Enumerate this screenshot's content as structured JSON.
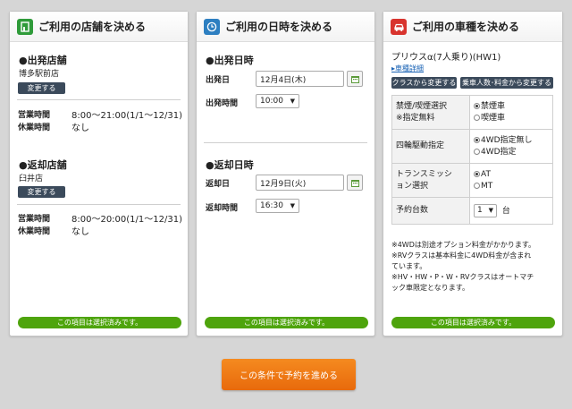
{
  "store_panel": {
    "title": "ご利用の店舗を決める",
    "departure": {
      "heading": "●出発店舗",
      "store_name": "博多駅前店",
      "change_label": "変更する",
      "hours_label": "営業時間",
      "hours_value": "8:00～21:00(1/1～12/31)",
      "closed_label": "休業時間",
      "closed_value": "なし"
    },
    "return": {
      "heading": "●返却店舗",
      "store_name": "臼井店",
      "change_label": "変更する",
      "hours_label": "営業時間",
      "hours_value": "8:00～20:00(1/1～12/31)",
      "closed_label": "休業時間",
      "closed_value": "なし"
    },
    "status": "この項目は選択済みです。"
  },
  "datetime_panel": {
    "title": "ご利用の日時を決める",
    "departure": {
      "heading": "●出発日時",
      "date_label": "出発日",
      "date_value": "12月4日(木)",
      "time_label": "出発時間",
      "time_value": "10:00"
    },
    "return": {
      "heading": "●返却日時",
      "date_label": "返却日",
      "date_value": "12月9日(火)",
      "time_label": "返却時間",
      "time_value": "16:30"
    },
    "status": "この項目は選択済みです。"
  },
  "car_panel": {
    "title": "ご利用の車種を決める",
    "car_name": "プリウスα(7人乗り)(HW1)",
    "details_link": "▸車種詳細",
    "change_class_label": "クラスから変更する",
    "change_capacity_label": "乗車人数･料金から変更する",
    "options": [
      {
        "label1": "禁煙/喫煙選択",
        "label2": "※指定無料",
        "choices": [
          "禁煙車",
          "喫煙車"
        ],
        "selected": 0
      },
      {
        "label1": "四輪駆動指定",
        "label2": "",
        "choices": [
          "4WD指定無し",
          "4WD指定"
        ],
        "selected": 0
      },
      {
        "label1": "トランスミッシ",
        "label2": "ョン選択",
        "choices": [
          "AT",
          "MT"
        ],
        "selected": 0
      }
    ],
    "quantity_label": "予約台数",
    "quantity_value": "1",
    "quantity_unit": "台",
    "notes": [
      "※4WDは別途オプション料金がかかります。",
      "※RVクラスは基本料金に4WD料金が含まれ",
      "ています。",
      "※HV・HW・P・W・RVクラスはオートマチ",
      "ック車限定となります。"
    ],
    "status": "この項目は選択済みです。"
  },
  "submit_label": "この条件で予約を進める",
  "colors": {
    "accent_green": "#4ea40c",
    "cta_orange": "#ef7a15",
    "dark_button": "#3b4a5b"
  }
}
